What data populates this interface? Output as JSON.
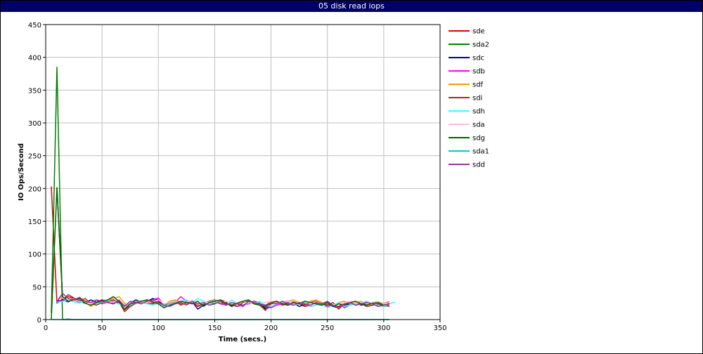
{
  "chart_data": {
    "type": "line",
    "title": "05 disk read iops",
    "xlabel": "Time (secs.)",
    "ylabel": "IO Ops/Second",
    "xlim": [
      0,
      350
    ],
    "ylim": [
      0,
      450
    ],
    "xticks": [
      0,
      50,
      100,
      150,
      200,
      250,
      300,
      350
    ],
    "yticks": [
      0,
      50,
      100,
      150,
      200,
      250,
      300,
      350,
      400,
      450
    ],
    "grid": true,
    "legend_position": "right",
    "series": [
      {
        "name": "sde",
        "color": "#e00000",
        "x": [
          5,
          10,
          15,
          20,
          25,
          30,
          35,
          40,
          45,
          50,
          55,
          60,
          65,
          70,
          75,
          80,
          85,
          90,
          95,
          100,
          105,
          110,
          115,
          120,
          125,
          130,
          135,
          140,
          145,
          150,
          155,
          160,
          165,
          170,
          175,
          180,
          185,
          190,
          195,
          200,
          205,
          210,
          215,
          220,
          225,
          230,
          235,
          240,
          245,
          250,
          255,
          260,
          265,
          270,
          275,
          280,
          285,
          290,
          295,
          300,
          305
        ],
        "y": [
          203,
          25,
          30,
          35,
          32,
          30,
          28,
          25,
          27,
          30,
          28,
          25,
          27,
          15,
          22,
          25,
          28,
          26,
          24,
          28,
          22,
          25,
          27,
          24,
          26,
          28,
          20,
          24,
          28,
          25,
          30,
          27,
          22,
          25,
          20,
          28,
          25,
          22,
          18,
          24,
          26,
          22,
          25,
          27,
          24,
          20,
          22,
          26,
          25,
          23,
          21,
          20,
          24,
          26,
          22,
          25,
          27,
          24,
          20,
          25,
          27
        ]
      },
      {
        "name": "sda2",
        "color": "#008000",
        "x": [
          5,
          10,
          15,
          20,
          25,
          30,
          50,
          100,
          150,
          200,
          250,
          300,
          305
        ],
        "y": [
          10,
          385,
          0,
          0,
          0,
          0,
          0,
          0,
          0,
          0,
          0,
          0,
          0
        ]
      },
      {
        "name": "sdc",
        "color": "#000099",
        "x": [
          10,
          15,
          20,
          25,
          30,
          35,
          40,
          45,
          50,
          55,
          60,
          65,
          70,
          75,
          80,
          85,
          90,
          95,
          100,
          105,
          110,
          115,
          120,
          125,
          130,
          135,
          140,
          145,
          150,
          155,
          160,
          165,
          170,
          175,
          180,
          185,
          190,
          195,
          200,
          205,
          210,
          215,
          220,
          225,
          230,
          235,
          240,
          245,
          250,
          255,
          260,
          265,
          270,
          275,
          280,
          285,
          290,
          295,
          300,
          305
        ],
        "y": [
          28,
          30,
          27,
          32,
          28,
          25,
          30,
          27,
          29,
          26,
          24,
          28,
          22,
          25,
          30,
          27,
          28,
          32,
          30,
          20,
          25,
          28,
          26,
          24,
          27,
          16,
          22,
          25,
          24,
          28,
          26,
          20,
          24,
          22,
          26,
          28,
          25,
          16,
          20,
          24,
          26,
          22,
          25,
          20,
          23,
          26,
          24,
          22,
          25,
          20,
          18,
          22,
          24,
          26,
          22,
          24,
          25,
          22,
          20,
          22
        ]
      },
      {
        "name": "sdb",
        "color": "#ff00ff",
        "x": [
          10,
          15,
          20,
          25,
          30,
          35,
          40,
          45,
          50,
          55,
          60,
          65,
          70,
          75,
          80,
          85,
          90,
          95,
          100,
          105,
          110,
          115,
          120,
          125,
          130,
          135,
          140,
          145,
          150,
          155,
          160,
          165,
          170,
          175,
          180,
          185,
          190,
          195,
          200,
          205,
          210,
          215,
          220,
          225,
          230,
          235,
          240,
          245,
          250,
          255,
          260,
          265,
          270,
          275,
          280,
          285,
          290,
          295,
          300,
          305
        ],
        "y": [
          25,
          32,
          28,
          30,
          26,
          28,
          25,
          27,
          24,
          26,
          28,
          24,
          22,
          20,
          25,
          27,
          24,
          30,
          33,
          22,
          24,
          26,
          35,
          28,
          25,
          22,
          24,
          26,
          28,
          24,
          22,
          25,
          20,
          22,
          24,
          26,
          22,
          20,
          18,
          22,
          24,
          26,
          22,
          25,
          24,
          20,
          22,
          24,
          20,
          22,
          25,
          18,
          22,
          24,
          26,
          20,
          22,
          24,
          22,
          25
        ]
      },
      {
        "name": "sdf",
        "color": "#ff9900",
        "x": [
          10,
          15,
          20,
          25,
          30,
          35,
          40,
          45,
          50,
          55,
          60,
          65,
          70,
          75,
          80,
          85,
          90,
          95,
          100,
          105,
          110,
          115,
          120,
          125,
          130,
          135,
          140,
          145,
          150,
          155,
          160,
          165,
          170,
          175,
          180,
          185,
          190,
          195,
          200,
          205,
          210,
          215,
          220,
          225,
          230,
          235,
          240,
          245,
          250,
          255,
          260,
          265,
          270,
          275,
          280,
          285,
          290,
          295,
          300,
          305
        ],
        "y": [
          30,
          35,
          28,
          32,
          30,
          27,
          20,
          25,
          28,
          30,
          32,
          35,
          25,
          22,
          28,
          24,
          30,
          27,
          25,
          22,
          28,
          30,
          26,
          24,
          28,
          22,
          26,
          24,
          30,
          28,
          26,
          22,
          24,
          28,
          30,
          26,
          24,
          22,
          28,
          26,
          24,
          28,
          30,
          26,
          24,
          28,
          30,
          26,
          24,
          22,
          26,
          28,
          24,
          26,
          28,
          24,
          22,
          26,
          24,
          22
        ]
      },
      {
        "name": "sdi",
        "color": "#a52a2a",
        "x": [
          10,
          15,
          20,
          25,
          30,
          35,
          40,
          45,
          50,
          55,
          60,
          65,
          70,
          75,
          80,
          85,
          90,
          95,
          100,
          105,
          110,
          115,
          120,
          125,
          130,
          135,
          140,
          145,
          150,
          155,
          160,
          165,
          170,
          175,
          180,
          185,
          190,
          195,
          200,
          205,
          210,
          215,
          220,
          225,
          230,
          235,
          240,
          245,
          250,
          255,
          260,
          265,
          270,
          275,
          280,
          285,
          290,
          295,
          300,
          305
        ],
        "y": [
          202,
          30,
          38,
          33,
          28,
          32,
          25,
          22,
          26,
          28,
          30,
          27,
          12,
          20,
          25,
          28,
          30,
          26,
          24,
          20,
          26,
          28,
          22,
          26,
          28,
          20,
          24,
          28,
          30,
          24,
          26,
          22,
          20,
          26,
          28,
          24,
          22,
          14,
          26,
          28,
          24,
          22,
          26,
          24,
          22,
          26,
          28,
          24,
          22,
          26,
          16,
          24,
          26,
          22,
          24,
          20,
          22,
          24,
          22,
          20
        ]
      },
      {
        "name": "sdh",
        "color": "#33ffff",
        "x": [
          10,
          15,
          20,
          25,
          30,
          35,
          40,
          45,
          50,
          55,
          60,
          65,
          70,
          75,
          80,
          85,
          90,
          95,
          100,
          105,
          110,
          115,
          120,
          125,
          130,
          135,
          140,
          145,
          150,
          155,
          160,
          165,
          170,
          175,
          180,
          185,
          190,
          195,
          200,
          205,
          210,
          215,
          220,
          225,
          230,
          235,
          240,
          245,
          250,
          255,
          260,
          265,
          270,
          275,
          280,
          285,
          290,
          295,
          300,
          305,
          310
        ],
        "y": [
          26,
          28,
          30,
          27,
          25,
          28,
          26,
          24,
          27,
          29,
          26,
          24,
          20,
          22,
          26,
          28,
          24,
          22,
          25,
          20,
          24,
          26,
          28,
          30,
          26,
          32,
          28,
          24,
          26,
          28,
          22,
          30,
          24,
          20,
          26,
          24,
          28,
          22,
          20,
          24,
          26,
          28,
          22,
          24,
          26,
          20,
          22,
          24,
          18,
          22,
          26,
          20,
          22,
          24,
          26,
          28,
          24,
          22,
          20,
          24,
          27
        ]
      },
      {
        "name": "sda",
        "color": "#ffc0cb",
        "x": [
          10,
          15,
          20,
          25,
          30,
          35,
          40,
          45,
          50,
          55,
          60,
          65,
          70,
          75,
          80,
          85,
          90,
          95,
          100,
          105,
          110,
          115,
          120,
          125,
          130,
          135,
          140,
          145,
          150,
          155,
          160,
          165,
          170,
          175,
          180,
          185,
          190,
          195,
          200,
          205,
          210,
          215,
          220,
          225,
          230,
          235,
          240,
          245,
          250,
          255,
          260,
          265,
          270,
          275,
          280,
          285,
          290,
          295,
          300,
          305
        ],
        "y": [
          30,
          33,
          29,
          31,
          27,
          29,
          24,
          26,
          28,
          25,
          27,
          29,
          23,
          25,
          27,
          29,
          26,
          28,
          30,
          24,
          26,
          28,
          25,
          27,
          29,
          23,
          25,
          27,
          29,
          26,
          28,
          24,
          26,
          28,
          25,
          27,
          24,
          26,
          28,
          25,
          27,
          29,
          24,
          26,
          28,
          25,
          27,
          24,
          26,
          22,
          24,
          26,
          28,
          25,
          27,
          24,
          26,
          28,
          25,
          26
        ]
      },
      {
        "name": "sdg",
        "color": "#006400",
        "x": [
          5,
          10,
          15,
          20,
          25,
          30,
          35,
          40,
          45,
          50,
          55,
          60,
          65,
          70,
          75,
          80,
          85,
          90,
          95,
          100,
          105,
          110,
          115,
          120,
          125,
          130,
          135,
          140,
          145,
          150,
          155,
          160,
          165,
          170,
          175,
          180,
          185,
          190,
          195,
          200,
          205,
          210,
          215,
          220,
          225,
          230,
          235,
          240,
          245,
          250,
          255,
          260,
          265,
          270,
          275,
          280,
          285,
          290,
          295,
          300,
          305
        ],
        "y": [
          0,
          201,
          35,
          28,
          30,
          32,
          25,
          22,
          26,
          28,
          30,
          35,
          28,
          16,
          24,
          26,
          28,
          30,
          27,
          24,
          18,
          22,
          25,
          28,
          26,
          24,
          28,
          20,
          26,
          28,
          30,
          24,
          22,
          25,
          28,
          30,
          24,
          22,
          20,
          26,
          28,
          24,
          22,
          26,
          24,
          28,
          26,
          24,
          22,
          26,
          20,
          24,
          22,
          26,
          28,
          24,
          22,
          25,
          26,
          22,
          24
        ]
      },
      {
        "name": "sda1",
        "color": "#00cccc",
        "x": [
          5,
          10,
          15,
          20,
          25,
          30,
          50,
          100,
          150,
          200,
          250,
          300,
          305
        ],
        "y": [
          0,
          0,
          0,
          1,
          0,
          0,
          0,
          0,
          0,
          0,
          0,
          0,
          0
        ]
      },
      {
        "name": "sdd",
        "color": "#993399",
        "x": [
          10,
          15,
          20,
          25,
          30,
          35,
          40,
          45,
          50,
          55,
          60,
          65,
          70,
          75,
          80,
          85,
          90,
          95,
          100,
          105,
          110,
          115,
          120,
          125,
          130,
          135,
          140,
          145,
          150,
          155,
          160,
          165,
          170,
          175,
          180,
          185,
          190,
          195,
          200,
          205,
          210,
          215,
          220,
          225,
          230,
          235,
          240,
          245,
          250,
          255,
          260,
          265,
          270,
          275,
          280,
          285,
          290,
          295,
          300,
          305
        ],
        "y": [
          28,
          40,
          32,
          30,
          34,
          28,
          26,
          30,
          28,
          26,
          24,
          30,
          20,
          28,
          26,
          24,
          28,
          30,
          26,
          22,
          20,
          24,
          26,
          22,
          28,
          24,
          26,
          22,
          24,
          28,
          22,
          26,
          24,
          20,
          28,
          26,
          24,
          22,
          26,
          24,
          28,
          24,
          22,
          26,
          24,
          22,
          26,
          24,
          28,
          22,
          18,
          24,
          26,
          22,
          24,
          26,
          24,
          20,
          22,
          24
        ]
      }
    ]
  }
}
